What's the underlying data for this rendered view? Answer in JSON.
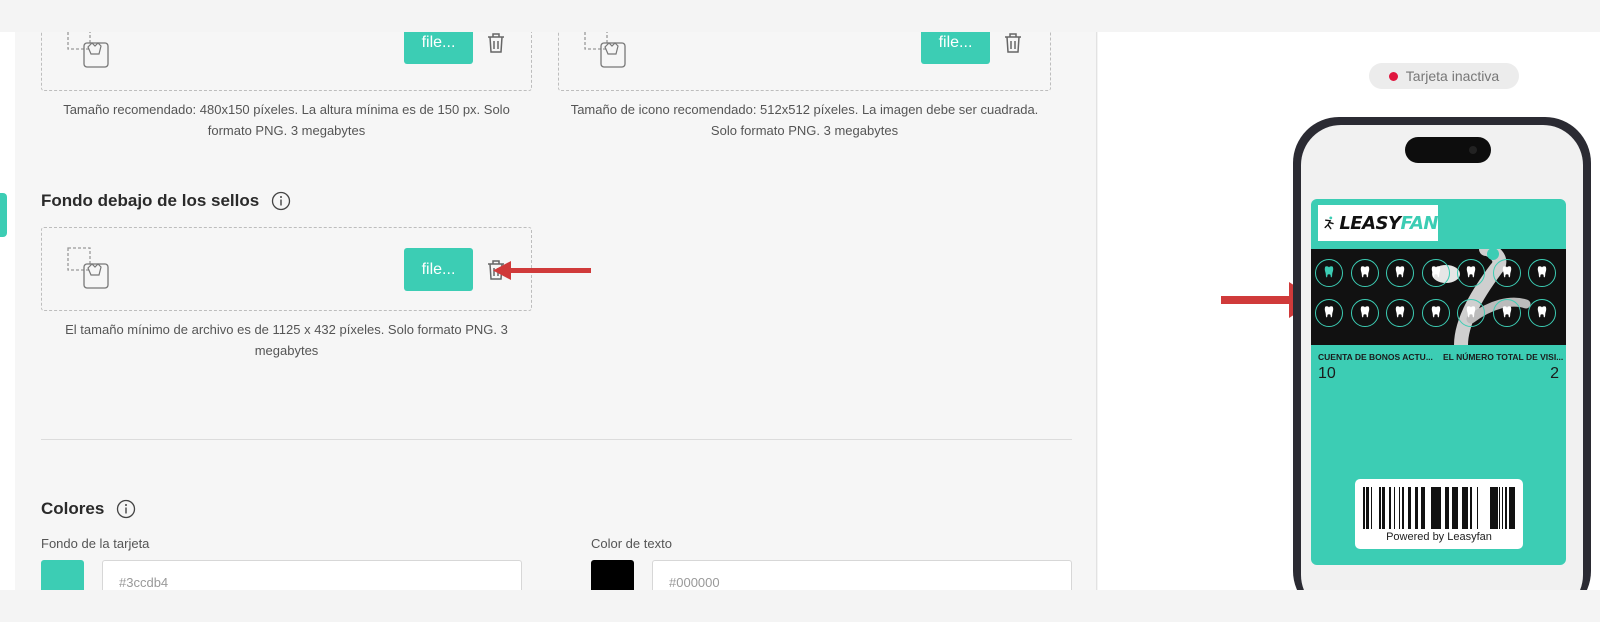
{
  "uploads": {
    "button_label": "file...",
    "hint_top_left": "Tamaño recomendado: 480x150 píxeles. La altura mínima es de 150 px. Solo formato PNG. 3 megabytes",
    "hint_top_right": "Tamaño de icono recomendado: 512x512 píxeles. La imagen debe ser cuadrada. Solo formato PNG. 3 megabytes",
    "stamps_background": {
      "title": "Fondo debajo de los sellos",
      "hint": "El tamaño mínimo de archivo es de 1125 x 432 píxeles. Solo formato PNG. 3 megabytes"
    }
  },
  "colors": {
    "title": "Colores",
    "card_background": {
      "label": "Fondo de la tarjeta",
      "value": "#3ccdb4",
      "text": "#3ccdb4"
    },
    "text_color": {
      "label": "Color de texto",
      "value": "#000000",
      "text": "#000000"
    }
  },
  "preview": {
    "status": "Tarjeta inactiva",
    "status_color": "#e0163f",
    "pass": {
      "logo": {
        "part1": "LEASY",
        "part2": "FAN"
      },
      "stamp_rows": 2,
      "stamp_cols": 7,
      "stamps_filled": 1,
      "fields": [
        {
          "label": "CUENTA DE BONOS ACTU...",
          "value": "10"
        },
        {
          "label": "EL NÚMERO TOTAL DE VISI...",
          "value": "2"
        }
      ],
      "powered_by": "Powered by Leasyfan"
    }
  },
  "theme": {
    "accent": "#3ccdb4",
    "arrow": "#d03a3a"
  }
}
